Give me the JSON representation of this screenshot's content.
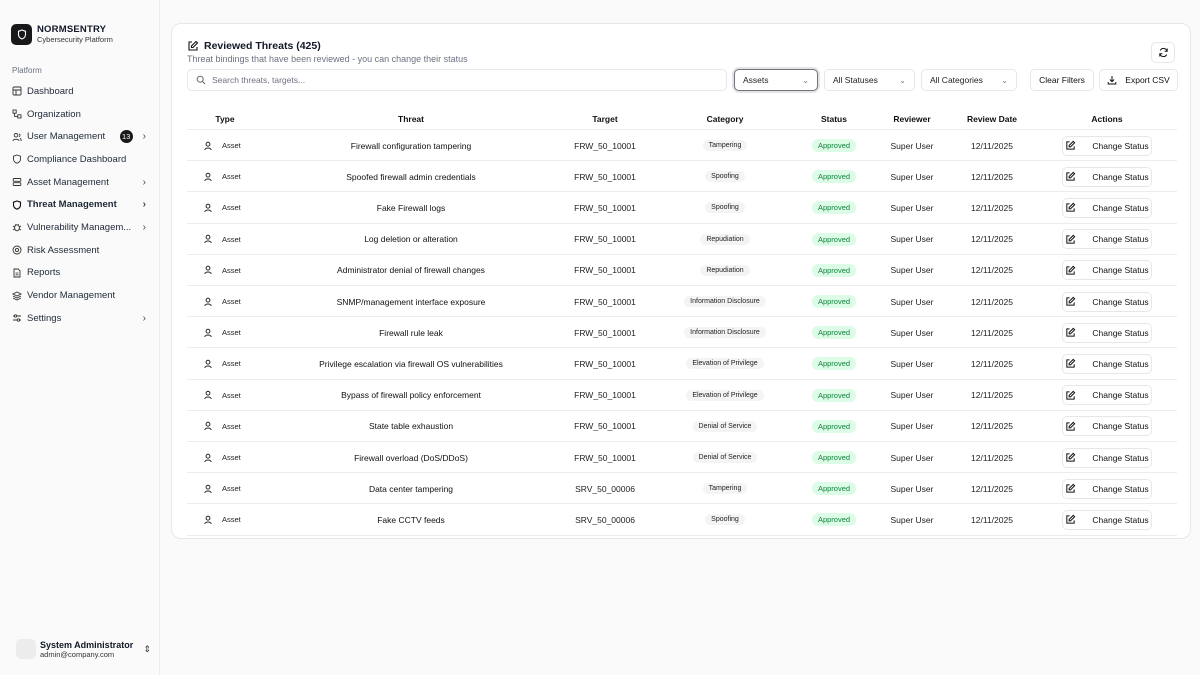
{
  "app": {
    "name": "NORMSENTRY",
    "subtitle": "Cybersecurity Platform"
  },
  "sidebar": {
    "section": "Platform",
    "items": [
      {
        "label": "Dashboard",
        "icon": "layout-icon"
      },
      {
        "label": "Organization",
        "icon": "organization-icon"
      },
      {
        "label": "User Management",
        "icon": "users-icon",
        "badge": "13",
        "chevron": true
      },
      {
        "label": "Compliance Dashboard",
        "icon": "shield-icon"
      },
      {
        "label": "Asset Management",
        "icon": "database-icon",
        "chevron": true
      },
      {
        "label": "Threat Management",
        "icon": "shield-alert-icon",
        "chevron": true,
        "active": true
      },
      {
        "label": "Vulnerability Managem...",
        "icon": "bug-icon",
        "chevron": true
      },
      {
        "label": "Risk Assessment",
        "icon": "target-icon"
      },
      {
        "label": "Reports",
        "icon": "file-text-icon"
      },
      {
        "label": "Vendor Management",
        "icon": "layers-icon"
      },
      {
        "label": "Settings",
        "icon": "sliders-icon",
        "chevron": true
      }
    ],
    "user": {
      "name": "System Administrator",
      "email": "admin@company.com"
    }
  },
  "card": {
    "title": "Reviewed Threats (425)",
    "subtitle": "Threat bindings that have been reviewed - you can change their status"
  },
  "filters": {
    "search_placeholder": "Search threats, targets...",
    "type_value": "Assets",
    "status_value": "All Statuses",
    "category_value": "All Categories",
    "clear_label": "Clear Filters",
    "export_label": "Export CSV"
  },
  "table": {
    "headers": [
      "Type",
      "Threat",
      "Target",
      "Category",
      "Status",
      "Reviewer",
      "Review Date",
      "Actions"
    ],
    "action_label": "Change Status",
    "rows": [
      {
        "type": "Asset",
        "threat": "Firewall configuration tampering",
        "target": "FRW_50_10001",
        "category": "Tampering",
        "status": "Approved",
        "reviewer": "Super User",
        "date": "12/11/2025"
      },
      {
        "type": "Asset",
        "threat": "Spoofed firewall admin credentials",
        "target": "FRW_50_10001",
        "category": "Spoofing",
        "status": "Approved",
        "reviewer": "Super User",
        "date": "12/11/2025"
      },
      {
        "type": "Asset",
        "threat": "Fake Firewall logs",
        "target": "FRW_50_10001",
        "category": "Spoofing",
        "status": "Approved",
        "reviewer": "Super User",
        "date": "12/11/2025"
      },
      {
        "type": "Asset",
        "threat": "Log deletion or alteration",
        "target": "FRW_50_10001",
        "category": "Repudiation",
        "status": "Approved",
        "reviewer": "Super User",
        "date": "12/11/2025"
      },
      {
        "type": "Asset",
        "threat": "Administrator denial of firewall changes",
        "target": "FRW_50_10001",
        "category": "Repudiation",
        "status": "Approved",
        "reviewer": "Super User",
        "date": "12/11/2025"
      },
      {
        "type": "Asset",
        "threat": "SNMP/management interface exposure",
        "target": "FRW_50_10001",
        "category": "Information Disclosure",
        "status": "Approved",
        "reviewer": "Super User",
        "date": "12/11/2025"
      },
      {
        "type": "Asset",
        "threat": "Firewall rule leak",
        "target": "FRW_50_10001",
        "category": "Information Disclosure",
        "status": "Approved",
        "reviewer": "Super User",
        "date": "12/11/2025"
      },
      {
        "type": "Asset",
        "threat": "Privilege escalation via firewall OS vulnerabilities",
        "target": "FRW_50_10001",
        "category": "Elevation of Privilege",
        "status": "Approved",
        "reviewer": "Super User",
        "date": "12/11/2025"
      },
      {
        "type": "Asset",
        "threat": "Bypass of firewall policy enforcement",
        "target": "FRW_50_10001",
        "category": "Elevation of Privilege",
        "status": "Approved",
        "reviewer": "Super User",
        "date": "12/11/2025"
      },
      {
        "type": "Asset",
        "threat": "State table exhaustion",
        "target": "FRW_50_10001",
        "category": "Denial of Service",
        "status": "Approved",
        "reviewer": "Super User",
        "date": "12/11/2025"
      },
      {
        "type": "Asset",
        "threat": "Firewall overload (DoS/DDoS)",
        "target": "FRW_50_10001",
        "category": "Denial of Service",
        "status": "Approved",
        "reviewer": "Super User",
        "date": "12/11/2025"
      },
      {
        "type": "Asset",
        "threat": "Data center tampering",
        "target": "SRV_50_00006",
        "category": "Tampering",
        "status": "Approved",
        "reviewer": "Super User",
        "date": "12/11/2025"
      },
      {
        "type": "Asset",
        "threat": "Fake CCTV feeds",
        "target": "SRV_50_00006",
        "category": "Spoofing",
        "status": "Approved",
        "reviewer": "Super User",
        "date": "12/11/2025"
      }
    ]
  }
}
